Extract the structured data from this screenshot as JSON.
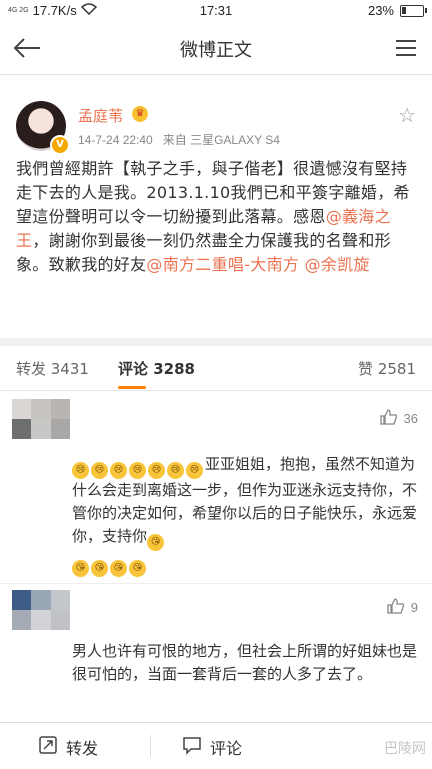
{
  "status_bar": {
    "signal": "4G 2G",
    "speed": "17.7K/s",
    "time": "17:31",
    "battery": "23%",
    "battery_level": 0.23
  },
  "nav": {
    "title": "微博正文"
  },
  "post": {
    "author": "孟庭苇",
    "date": "14-7-24 22:40",
    "source": "来自 三星GALAXY S4",
    "text_parts": [
      "我們曾經期許【執子之手，與子偕老】很遺憾沒有堅持走下去的人是我。2013.1.10我們已和平簽字離婚，希望這份聲明可以令一切紛擾到此落幕。感恩",
      "@義海之王",
      "，謝謝你到最後一刻仍然盡全力保護我的名聲和形象。致歉我的好友",
      "@南方二重唱-大南方",
      " ",
      "@余凯旋"
    ]
  },
  "tabs": {
    "repost": "转发 3431",
    "comments": "评论 3288",
    "likes": "赞 2581"
  },
  "comments": [
    {
      "likes": "36",
      "text": "亚亚姐姐，抱抱，虽然不知道为什么会走到离婚这一步，但作为亚迷永远支持你，不管你的决定如何，希望你以后的日子能快乐，永远爱你，支持你"
    },
    {
      "likes": "9",
      "text": "男人也许有可恨的地方，但社会上所谓的好姐妹也是很可怕的，当面一套背后一套的人多了去了。"
    }
  ],
  "bottom_bar": {
    "repost": "转发",
    "comment": "评论"
  },
  "watermark": "巴陵网",
  "colors": {
    "accent": "#eb7350",
    "tab_underline": "#ff8200"
  }
}
